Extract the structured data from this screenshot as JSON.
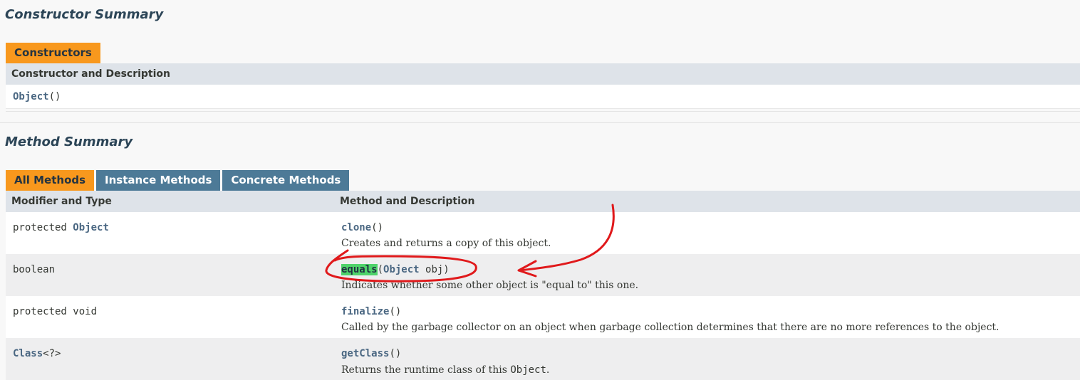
{
  "constructor_summary": {
    "title": "Constructor Summary",
    "tab": "Constructors",
    "header": "Constructor and Description",
    "rows": [
      {
        "name": "Object",
        "params": "()"
      }
    ]
  },
  "method_summary": {
    "title": "Method Summary",
    "tabs": [
      "All Methods",
      "Instance Methods",
      "Concrete Methods"
    ],
    "headers": [
      "Modifier and Type",
      "Method and Description"
    ],
    "rows": [
      {
        "modifier": "protected ",
        "type_link": "Object",
        "name": "clone",
        "signature": "()",
        "description": "Creates and returns a copy of this object."
      },
      {
        "modifier": "boolean",
        "name": "equals",
        "sig_open": "(",
        "param_type": "Object",
        "param_name": " obj)",
        "description": "Indicates whether some other object is \"equal to\" this one."
      },
      {
        "modifier": "protected void",
        "name": "finalize",
        "signature": "()",
        "description": "Called by the garbage collector on an object when garbage collection determines that there are no more references to the object."
      },
      {
        "type_link": "Class",
        "type_suffix": "<?>",
        "name": "getClass",
        "signature": "()",
        "desc_prefix": "Returns the runtime class of this ",
        "desc_code": "Object",
        "desc_suffix": "."
      }
    ]
  },
  "colors": {
    "active_tab": "#f8981d",
    "inactive_tab": "#4d7a97",
    "header_bg": "#dee3e9",
    "link": "#4a6782",
    "highlight": "#4fd36a",
    "annotation": "#e0191b"
  }
}
